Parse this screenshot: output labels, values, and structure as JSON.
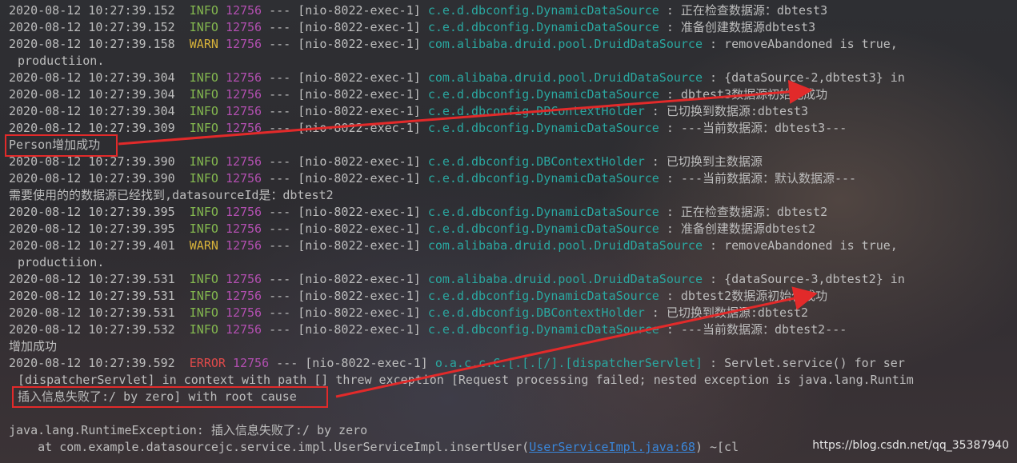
{
  "log_lines": [
    {
      "ts": "2020-08-12 10:27:39.152",
      "level": "INFO",
      "pid": "12756",
      "thread": "--- [nio-8022-exec-1]",
      "logger": "c.e.d.dbconfig.DynamicDataSource",
      "msg": ": 正在检查数据源：dbtest3"
    },
    {
      "ts": "2020-08-12 10:27:39.152",
      "level": "INFO",
      "pid": "12756",
      "thread": "--- [nio-8022-exec-1]",
      "logger": "c.e.d.dbconfig.DynamicDataSource",
      "msg": ": 准备创建数据源dbtest3"
    },
    {
      "ts": "2020-08-12 10:27:39.158",
      "level": "WARN",
      "pid": "12756",
      "thread": "--- [nio-8022-exec-1]",
      "logger": "com.alibaba.druid.pool.DruidDataSource",
      "msg": ": removeAbandoned is true,"
    },
    {
      "text": "productiion."
    },
    {
      "ts": "2020-08-12 10:27:39.304",
      "level": "INFO",
      "pid": "12756",
      "thread": "--- [nio-8022-exec-1]",
      "logger": "com.alibaba.druid.pool.DruidDataSource",
      "msg": ": {dataSource-2,dbtest3} in"
    },
    {
      "ts": "2020-08-12 10:27:39.304",
      "level": "INFO",
      "pid": "12756",
      "thread": "--- [nio-8022-exec-1]",
      "logger": "c.e.d.dbconfig.DynamicDataSource",
      "msg": ": dbtest3数据源初始化成功"
    },
    {
      "ts": "2020-08-12 10:27:39.304",
      "level": "INFO",
      "pid": "12756",
      "thread": "--- [nio-8022-exec-1]",
      "logger": "c.e.d.dbconfig.DBContextHolder",
      "msg": ": 已切换到数据源:dbtest3"
    },
    {
      "ts": "2020-08-12 10:27:39.309",
      "level": "INFO",
      "pid": "12756",
      "thread": "--- [nio-8022-exec-1]",
      "logger": "c.e.d.dbconfig.DynamicDataSource",
      "msg": ": ---当前数据源：dbtest3---"
    },
    {
      "text": "Person增加成功"
    },
    {
      "ts": "2020-08-12 10:27:39.390",
      "level": "INFO",
      "pid": "12756",
      "thread": "--- [nio-8022-exec-1]",
      "logger": "c.e.d.dbconfig.DBContextHolder",
      "msg": ": 已切换到主数据源"
    },
    {
      "ts": "2020-08-12 10:27:39.390",
      "level": "INFO",
      "pid": "12756",
      "thread": "--- [nio-8022-exec-1]",
      "logger": "c.e.d.dbconfig.DynamicDataSource",
      "msg": ": ---当前数据源：默认数据源---"
    },
    {
      "text": "需要使用的的数据源已经找到,datasourceId是：dbtest2"
    },
    {
      "ts": "2020-08-12 10:27:39.395",
      "level": "INFO",
      "pid": "12756",
      "thread": "--- [nio-8022-exec-1]",
      "logger": "c.e.d.dbconfig.DynamicDataSource",
      "msg": ": 正在检查数据源：dbtest2"
    },
    {
      "ts": "2020-08-12 10:27:39.395",
      "level": "INFO",
      "pid": "12756",
      "thread": "--- [nio-8022-exec-1]",
      "logger": "c.e.d.dbconfig.DynamicDataSource",
      "msg": ": 准备创建数据源dbtest2"
    },
    {
      "ts": "2020-08-12 10:27:39.401",
      "level": "WARN",
      "pid": "12756",
      "thread": "--- [nio-8022-exec-1]",
      "logger": "com.alibaba.druid.pool.DruidDataSource",
      "msg": ": removeAbandoned is true,"
    },
    {
      "text": "productiion."
    },
    {
      "ts": "2020-08-12 10:27:39.531",
      "level": "INFO",
      "pid": "12756",
      "thread": "--- [nio-8022-exec-1]",
      "logger": "com.alibaba.druid.pool.DruidDataSource",
      "msg": ": {dataSource-3,dbtest2} in"
    },
    {
      "ts": "2020-08-12 10:27:39.531",
      "level": "INFO",
      "pid": "12756",
      "thread": "--- [nio-8022-exec-1]",
      "logger": "c.e.d.dbconfig.DynamicDataSource",
      "msg": ": dbtest2数据源初始化成功"
    },
    {
      "ts": "2020-08-12 10:27:39.531",
      "level": "INFO",
      "pid": "12756",
      "thread": "--- [nio-8022-exec-1]",
      "logger": "c.e.d.dbconfig.DBContextHolder",
      "msg": ": 已切换到数据源:dbtest2"
    },
    {
      "ts": "2020-08-12 10:27:39.532",
      "level": "INFO",
      "pid": "12756",
      "thread": "--- [nio-8022-exec-1]",
      "logger": "c.e.d.dbconfig.DynamicDataSource",
      "msg": ": ---当前数据源：dbtest2---"
    },
    {
      "text": "增加成功"
    },
    {
      "ts": "2020-08-12 10:27:39.592",
      "level": "ERROR",
      "pid": "12756",
      "thread": "--- [nio-8022-exec-1]",
      "logger": "o.a.c.c.C.[.[.[/].[dispatcherServlet]",
      "msg": ": Servlet.service() for ser"
    },
    {
      "text": "[dispatcherServlet] in context with path [] threw exception [Request processing failed; nested exception is java.lang.Runtim"
    },
    {
      "text": "插入信息失败了:/ by zero] with root cause"
    },
    {
      "text": ""
    },
    {
      "text": "java.lang.RuntimeException: 插入信息失败了:/ by zero"
    },
    {
      "trace_prefix": "    at com.example.datasourcejc.service.impl.UserServiceImpl.insertUser(",
      "trace_link": "UserServiceImpl.java:68",
      "trace_suffix": ") ~[cl"
    }
  ],
  "watermark": "https://blog.csdn.net/qq_35387940",
  "colors": {
    "info": "#83b74f",
    "warn": "#d7b23a",
    "error": "#e04a4a",
    "pid": "#b24fb0",
    "logger": "#2aa7a0",
    "highlight": "#e22a2a"
  }
}
